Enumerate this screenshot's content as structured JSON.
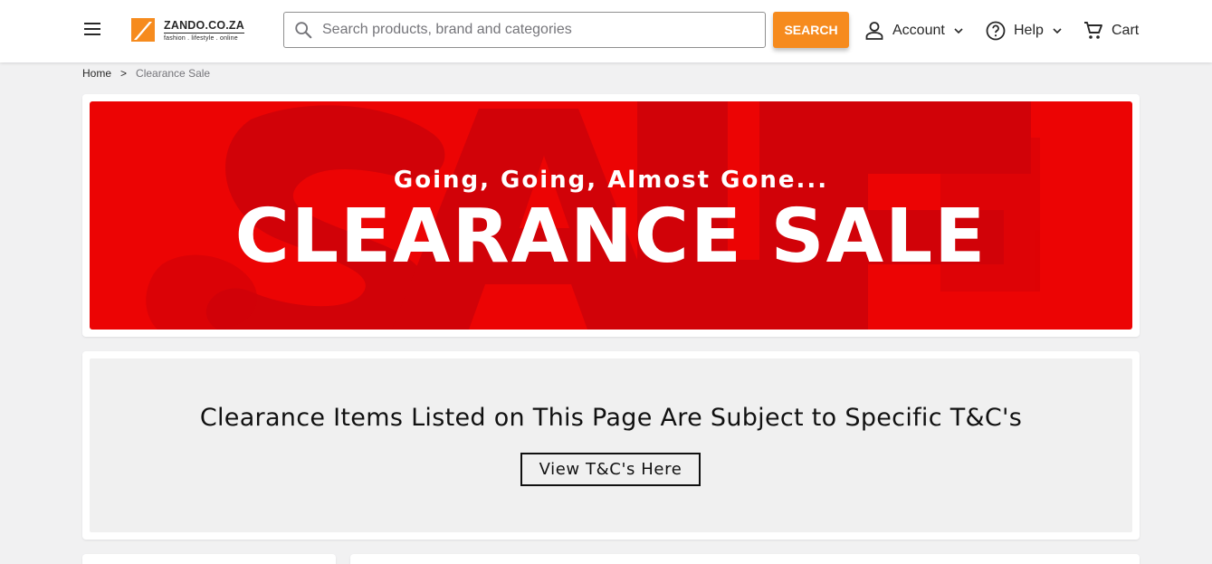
{
  "header": {
    "menu_icon": "hamburger-menu-icon",
    "logo": {
      "name": "ZANDO.CO.ZA",
      "tagline": "fashion . lifestyle . online"
    },
    "search": {
      "placeholder": "Search products, brand and categories",
      "button_label": "SEARCH"
    },
    "nav": {
      "account": {
        "label": "Account",
        "icon": "user-icon"
      },
      "help": {
        "label": "Help",
        "icon": "question-circle-icon"
      },
      "cart": {
        "label": "Cart",
        "icon": "cart-icon"
      }
    }
  },
  "breadcrumb": {
    "home": "Home",
    "separator": ">",
    "current": "Clearance Sale"
  },
  "banner": {
    "subtitle": "Going, Going, Almost Gone...",
    "title": "CLEARANCE SALE",
    "background_color": "#ec0404"
  },
  "terms": {
    "text": "Clearance Items Listed on This Page Are Subject to Specific T&C's",
    "button_label": "View T&C's Here"
  },
  "colors": {
    "accent": "#f68b1e",
    "page_bg": "#f1f1f2"
  }
}
